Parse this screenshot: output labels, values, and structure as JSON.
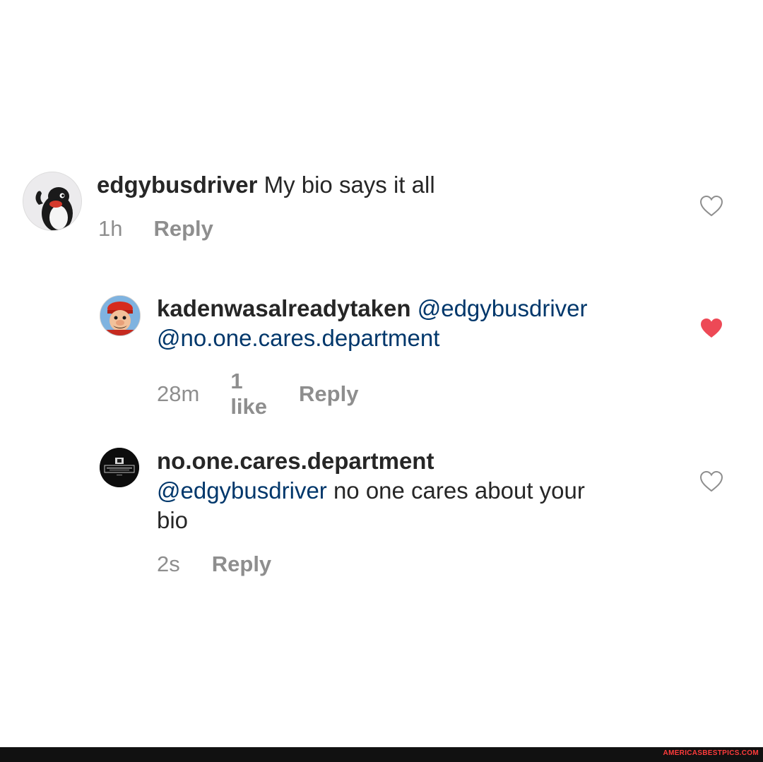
{
  "comments": [
    {
      "username": "edgybusdriver",
      "mentions": [],
      "text": "My bio says it all",
      "time": "1h",
      "likes_label": "",
      "reply_label": "Reply",
      "liked": false
    },
    {
      "username": "kadenwasalreadytaken",
      "mentions": [
        "@edgybusdriver",
        "@no.one.cares.department"
      ],
      "text": "",
      "time": "28m",
      "likes_label": "1 like",
      "reply_label": "Reply",
      "liked": true
    },
    {
      "username": "no.one.cares.department",
      "mentions": [
        "@edgybusdriver"
      ],
      "text": "no one cares about your",
      "text_line2": "bio",
      "time": "2s",
      "likes_label": "",
      "reply_label": "Reply",
      "liked": false
    }
  ],
  "colors": {
    "username": "#262626",
    "mention": "#00376b",
    "meta": "#8e8e8e",
    "heart_liked": "#ed4956",
    "heart_outline": "#8e8e8e"
  },
  "icons": {
    "like_empty": "heart-outline-icon",
    "like_filled": "heart-filled-icon"
  },
  "watermark": "AMERICASBESTPICS.COM"
}
